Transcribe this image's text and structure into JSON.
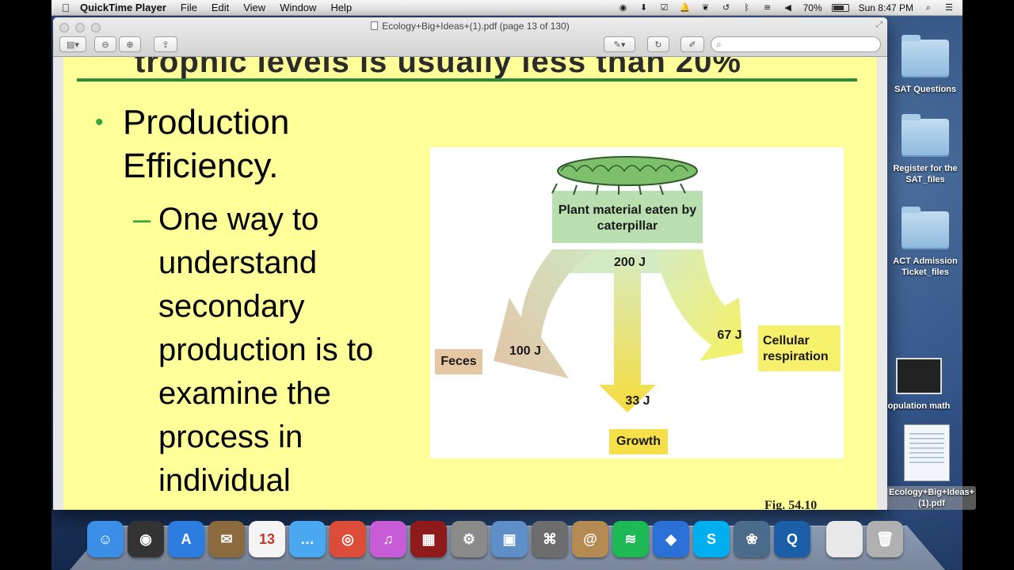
{
  "menubar": {
    "apple": "",
    "app_name": "QuickTime Player",
    "menus": [
      "File",
      "Edit",
      "View",
      "Window",
      "Help"
    ],
    "battery": "70%",
    "clock": "Sun 8:47 PM"
  },
  "window": {
    "title": "Ecology+Big+Ideas+(1).pdf (page 13 of 130)",
    "search_placeholder": ""
  },
  "slide": {
    "title_fragment": "trophic levels is usually less than 20%",
    "bullet": "Production Efficiency.",
    "bullet_marker": "•",
    "sub_marker": "–",
    "sub_bullet": "One way to understand secondary production is to examine the process in individual animals.",
    "figure": {
      "source": "Plant material eaten by caterpillar",
      "source_value": "200 J",
      "feces_label": "Feces",
      "feces_value": "100 J",
      "growth_label": "Growth",
      "growth_value": "33 J",
      "respiration_label": "Cellular respiration",
      "respiration_value": "67 J",
      "colors": {
        "feces": "#e6c7a3",
        "growth": "#f5e04a",
        "respiration": "#f7f06a",
        "source": "#bfe0b0"
      }
    },
    "fig_number": "Fig. 54.10"
  },
  "desktop_icons": [
    {
      "label": "SAT Questions",
      "kind": "folder"
    },
    {
      "label": "Register for the SAT_files",
      "kind": "folder"
    },
    {
      "label": "ACT Admission Ticket_files",
      "kind": "folder"
    },
    {
      "label": "opulation math",
      "kind": "video"
    },
    {
      "label": "Ecology+Big+Ideas+(1).pdf",
      "kind": "pdf"
    }
  ],
  "dock": [
    {
      "name": "finder-icon",
      "color": "#3a8ee6",
      "glyph": "☺"
    },
    {
      "name": "dashboard-icon",
      "color": "#333333",
      "glyph": "◉"
    },
    {
      "name": "app-store-icon",
      "color": "#2d7de0",
      "glyph": "A"
    },
    {
      "name": "mail-icon",
      "color": "#8b6a3d",
      "glyph": "✉"
    },
    {
      "name": "calendar-icon",
      "color": "#f4f4f4",
      "glyph": "13"
    },
    {
      "name": "messages-icon",
      "color": "#4aa8f0",
      "glyph": "…"
    },
    {
      "name": "chrome-icon",
      "color": "#dd4b39",
      "glyph": "◎"
    },
    {
      "name": "itunes-icon",
      "color": "#c85cd6",
      "glyph": "♫"
    },
    {
      "name": "photo-booth-icon",
      "color": "#8e1a1a",
      "glyph": "▦"
    },
    {
      "name": "system-preferences-icon",
      "color": "#8a8a8a",
      "glyph": "⚙"
    },
    {
      "name": "preview-icon",
      "color": "#5e8fc8",
      "glyph": "▣"
    },
    {
      "name": "network-icon",
      "color": "#6d6d6d",
      "glyph": "⌘"
    },
    {
      "name": "contacts-icon",
      "color": "#b58a53",
      "glyph": "@"
    },
    {
      "name": "spotify-icon",
      "color": "#1db954",
      "glyph": "≋"
    },
    {
      "name": "keynote-icon",
      "color": "#2a70d6",
      "glyph": "◆"
    },
    {
      "name": "skype-icon",
      "color": "#00aff0",
      "glyph": "S"
    },
    {
      "name": "iphoto-icon",
      "color": "#4a6b8a",
      "glyph": "❀"
    },
    {
      "name": "quicktime-icon",
      "color": "#1b5fa8",
      "glyph": "Q"
    },
    {
      "name": "document-icon",
      "color": "#e8e8e8",
      "glyph": ""
    },
    {
      "name": "trash-icon",
      "color": "#b0b0b0",
      "glyph": "🗑"
    }
  ]
}
